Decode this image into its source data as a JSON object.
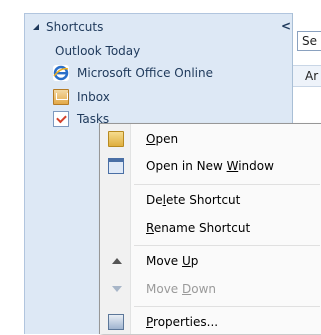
{
  "nav": {
    "header": "Shortcuts",
    "collapse_glyph": "<",
    "items": [
      {
        "label": "Outlook Today",
        "icon": null
      },
      {
        "label": "Microsoft Office Online",
        "icon": "internet-explorer-icon"
      },
      {
        "label": "Inbox",
        "icon": "inbox-icon"
      },
      {
        "label": "Tasks",
        "icon": "tasks-icon"
      }
    ]
  },
  "right_pane": {
    "box1_text": "Se",
    "box2_text": "Ar"
  },
  "context_menu": {
    "open": {
      "pre": "",
      "key": "O",
      "post": "pen"
    },
    "open_new_window": {
      "pre": "Open in New ",
      "key": "W",
      "post": "indow"
    },
    "delete_shortcut": {
      "pre": "De",
      "key": "l",
      "post": "ete Shortcut"
    },
    "rename_shortcut": {
      "pre": "",
      "key": "R",
      "post": "ename Shortcut"
    },
    "move_up": {
      "pre": "Move ",
      "key": "U",
      "post": "p"
    },
    "move_down": {
      "pre": "Move ",
      "key": "D",
      "post": "own"
    },
    "properties": {
      "pre": "",
      "key": "P",
      "post": "roperties..."
    }
  },
  "colors": {
    "nav_bg": "#dde8f5",
    "nav_text": "#1e395b",
    "menu_bg": "#fafafa",
    "disabled_text": "#9a9a9a"
  }
}
